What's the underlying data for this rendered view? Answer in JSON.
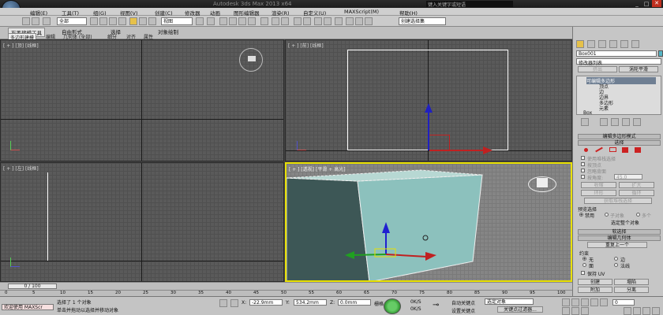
{
  "window": {
    "title": "Autodesk 3ds Max  2013 x64",
    "search_placeholder": "键入关键字或短语"
  },
  "menu": [
    "编辑(E)",
    "工具(T)",
    "组(G)",
    "视图(V)",
    "创建(C)",
    "修改器",
    "动画",
    "图形编辑器",
    "渲染(R)",
    "自定义(U)",
    "MAXScript(M)",
    "帮助(H)"
  ],
  "toolbar": {
    "filter_value": "全部",
    "coord_value": "视图",
    "named_sel_placeholder": "创建选择集"
  },
  "ribbon": {
    "tabs": [
      "石墨建模工具",
      "自由形式",
      "选择",
      "对象绘制"
    ],
    "active_tab": "石墨建模工具",
    "subtabs": [
      "多边形建模",
      "编辑",
      "几何体 (全部)",
      "细分",
      "对齐",
      "属性"
    ]
  },
  "viewports": {
    "top": "[ + ] [顶] [线框]",
    "front": "[ + ] [前] [线框]",
    "left": "[ + ] [左] [线框]",
    "persp": "[ + ] [透视] [平滑 + 高光]"
  },
  "panel": {
    "object_name": "Box001",
    "modifier_list": "修改器列表",
    "btn_extrude": "挤出",
    "btn_turbo": "涡轮平滑",
    "stack": [
      "可编辑多边形",
      "顶点",
      "边",
      "边界",
      "多边形",
      "元素",
      "Box"
    ],
    "rollout_edit_poly_mode": "编辑多边形模式",
    "rollout_select": "选择",
    "use_stack": "使用堆栈选择",
    "by_vertex": "按顶点",
    "ignore_backface": "忽略背面",
    "by_angle": "按角度:",
    "angle_value": "45.0",
    "btn_shrink": "收缩",
    "btn_grow": "扩大",
    "btn_ring": "环形",
    "btn_loop": "循环",
    "btn_get_stack": "获取堆栈选择",
    "preview_label": "预览选择",
    "preview_off": "禁用",
    "preview_sub": "子对象",
    "preview_multi": "多个",
    "selected_whole": "选定整个对象",
    "rollout_soft": "软选择",
    "rollout_edit_geom": "编辑几何体",
    "btn_repeat": "重复上一个",
    "constraint_label": "约束",
    "c_none": "无",
    "c_edge": "边",
    "c_face": "面",
    "c_normal": "法线",
    "keep_uv": "保持 UV",
    "btn_create": "创建",
    "btn_collapse": "塌陷",
    "btn_attach": "附加",
    "btn_detach": "分离"
  },
  "timeline": {
    "frame": "0 / 100",
    "ticks": [
      "0",
      "5",
      "10",
      "15",
      "20",
      "25",
      "30",
      "35",
      "40",
      "45",
      "50",
      "55",
      "60",
      "65",
      "70",
      "75",
      "80",
      "85",
      "90",
      "95",
      "100"
    ]
  },
  "status": {
    "welcome": "欢迎使用 MAXScr",
    "selected": "选择了 1 个对象",
    "hint": "单击并拖动以选择并移动对象",
    "x_label": "X:",
    "x_value": "-22.9mm",
    "y_label": "Y:",
    "y_value": "534.2mm",
    "z_label": "Z:",
    "z_value": "0.0mm",
    "grid": "栅格",
    "speed1": "0K/S",
    "speed2": "0K/S",
    "auto_key": "自动关键点",
    "set_key": "设置关键点",
    "sel_object": "选定对象",
    "key_filter": "关键点过滤器...",
    "frame_value": "0"
  }
}
